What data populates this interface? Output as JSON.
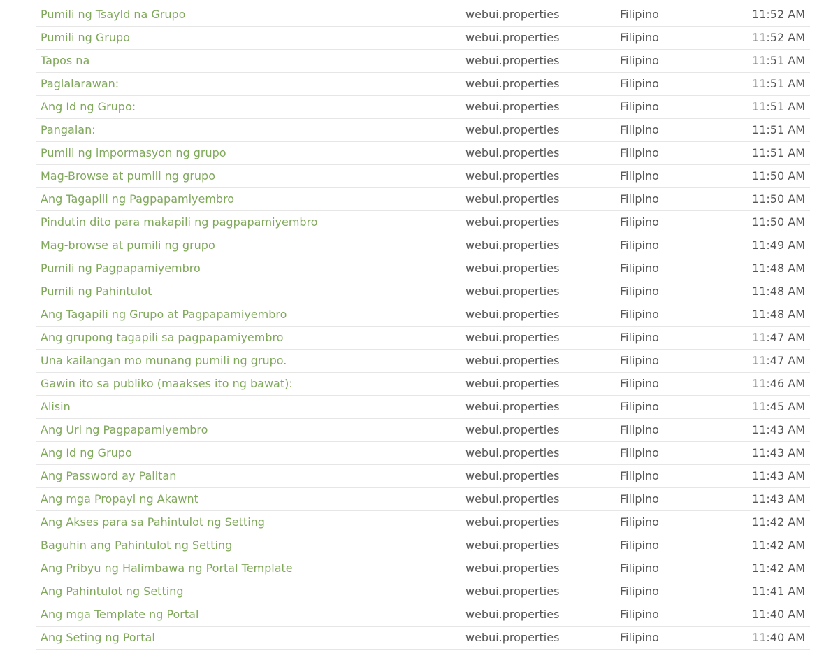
{
  "colors": {
    "link": "#7fa85a",
    "text": "#555555",
    "divider": "#e6e6e6"
  },
  "rows": [
    {
      "key": "Pumili ng Tsayld na Grupo",
      "file": "webui.properties",
      "language": "Filipino",
      "time": "11:52 AM"
    },
    {
      "key": "Pumili ng Grupo",
      "file": "webui.properties",
      "language": "Filipino",
      "time": "11:52 AM"
    },
    {
      "key": "Tapos na",
      "file": "webui.properties",
      "language": "Filipino",
      "time": "11:51 AM"
    },
    {
      "key": "Paglalarawan:",
      "file": "webui.properties",
      "language": "Filipino",
      "time": "11:51 AM"
    },
    {
      "key": "Ang Id ng Grupo:",
      "file": "webui.properties",
      "language": "Filipino",
      "time": "11:51 AM"
    },
    {
      "key": "Pangalan:",
      "file": "webui.properties",
      "language": "Filipino",
      "time": "11:51 AM"
    },
    {
      "key": "Pumili ng impormasyon ng grupo",
      "file": "webui.properties",
      "language": "Filipino",
      "time": "11:51 AM"
    },
    {
      "key": "Mag-Browse at pumili ng grupo",
      "file": "webui.properties",
      "language": "Filipino",
      "time": "11:50 AM"
    },
    {
      "key": "Ang Tagapili ng Pagpapamiyembro",
      "file": "webui.properties",
      "language": "Filipino",
      "time": "11:50 AM"
    },
    {
      "key": "Pindutin dito para makapili ng pagpapamiyembro",
      "file": "webui.properties",
      "language": "Filipino",
      "time": "11:50 AM"
    },
    {
      "key": "Mag-browse at pumili ng grupo",
      "file": "webui.properties",
      "language": "Filipino",
      "time": "11:49 AM"
    },
    {
      "key": "Pumili ng Pagpapamiyembro",
      "file": "webui.properties",
      "language": "Filipino",
      "time": "11:48 AM"
    },
    {
      "key": "Pumili ng Pahintulot",
      "file": "webui.properties",
      "language": "Filipino",
      "time": "11:48 AM"
    },
    {
      "key": "Ang Tagapili ng Grupo at Pagpapamiyembro",
      "file": "webui.properties",
      "language": "Filipino",
      "time": "11:48 AM"
    },
    {
      "key": "Ang grupong tagapili sa pagpapamiyembro",
      "file": "webui.properties",
      "language": "Filipino",
      "time": "11:47 AM"
    },
    {
      "key": "Una kailangan mo munang pumili ng grupo.",
      "file": "webui.properties",
      "language": "Filipino",
      "time": "11:47 AM"
    },
    {
      "key": "Gawin ito sa publiko (maakses ito ng bawat):",
      "file": "webui.properties",
      "language": "Filipino",
      "time": "11:46 AM"
    },
    {
      "key": "Alisin",
      "file": "webui.properties",
      "language": "Filipino",
      "time": "11:45 AM"
    },
    {
      "key": "Ang Uri ng Pagpapamiyembro",
      "file": "webui.properties",
      "language": "Filipino",
      "time": "11:43 AM"
    },
    {
      "key": "Ang Id ng Grupo",
      "file": "webui.properties",
      "language": "Filipino",
      "time": "11:43 AM"
    },
    {
      "key": "Ang Password ay Palitan",
      "file": "webui.properties",
      "language": "Filipino",
      "time": "11:43 AM"
    },
    {
      "key": "Ang mga Propayl ng Akawnt",
      "file": "webui.properties",
      "language": "Filipino",
      "time": "11:43 AM"
    },
    {
      "key": "Ang Akses para sa Pahintulot ng Setting",
      "file": "webui.properties",
      "language": "Filipino",
      "time": "11:42 AM"
    },
    {
      "key": "Baguhin ang Pahintulot ng Setting",
      "file": "webui.properties",
      "language": "Filipino",
      "time": "11:42 AM"
    },
    {
      "key": "Ang Pribyu ng Halimbawa ng Portal Template",
      "file": "webui.properties",
      "language": "Filipino",
      "time": "11:42 AM"
    },
    {
      "key": "Ang Pahintulot ng Setting",
      "file": "webui.properties",
      "language": "Filipino",
      "time": "11:41 AM"
    },
    {
      "key": "Ang mga Template ng Portal",
      "file": "webui.properties",
      "language": "Filipino",
      "time": "11:40 AM"
    },
    {
      "key": "Ang Seting ng Portal",
      "file": "webui.properties",
      "language": "Filipino",
      "time": "11:40 AM"
    }
  ]
}
